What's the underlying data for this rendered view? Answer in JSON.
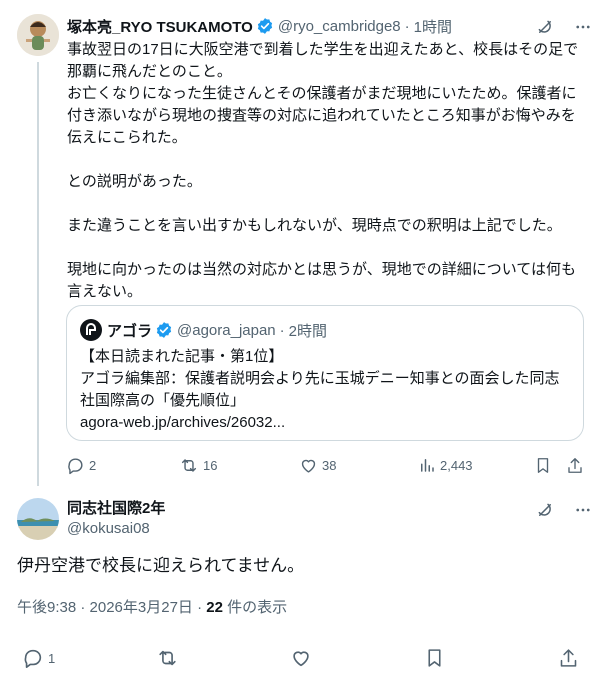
{
  "tweet": {
    "author_name": "塚本亮_RYO TSUKAMOTO",
    "handle": "@ryo_cambridge8",
    "dot": "·",
    "time": "1時間",
    "lines": [
      "事故翌日の17日に大阪空港で到着した学生を出迎えたあと、校長はその足で",
      "那覇に飛んだとのこと。",
      "お亡くなりになった生徒さんとその保護者がまだ現地にいたため。保護者に",
      "付き添いながら現地の捜査等の対応に追われていたところ知事がお悔やみを",
      "伝えにこられた。",
      "との説明があった。",
      "また違うことを言い出すかもしれないが、現時点での釈明は上記でした。",
      "現地に向かったのは当然の対応かとは思うが、現地での詳細については何も",
      "言えない。"
    ],
    "quote": {
      "name": "アゴラ",
      "handle": "@agora_japan",
      "dot": "·",
      "time": "2時間",
      "lines": [
        "【本日読まれた記事・第1位】",
        "アゴラ編集部：保護者説明会より先に玉城デニー知事との面会した同志",
        "社国際高の「優先順位」",
        "agora-web.jp/archives/26032..."
      ]
    },
    "stats": {
      "replies": "2",
      "retweets": "16",
      "likes": "38",
      "views": "2,443"
    },
    "icons": [
      "grok-icon",
      "more-icon",
      "reply-icon",
      "retweet-icon",
      "like-icon",
      "views-icon",
      "bookmark-icon",
      "share-icon"
    ],
    "colors": {
      "verified": "#1d9bf0",
      "muted": "#536471",
      "border": "#cfd9de"
    }
  },
  "reply": {
    "author_name": "同志社国際2年",
    "handle": "@kokusai08",
    "text": "伊丹空港で校長に迎えられてません。",
    "meta_time": "午後9:38 · 2026年3月27日 · ",
    "views_count": "22",
    "views_label": " 件の表示",
    "stats": {
      "replies": "1"
    }
  }
}
